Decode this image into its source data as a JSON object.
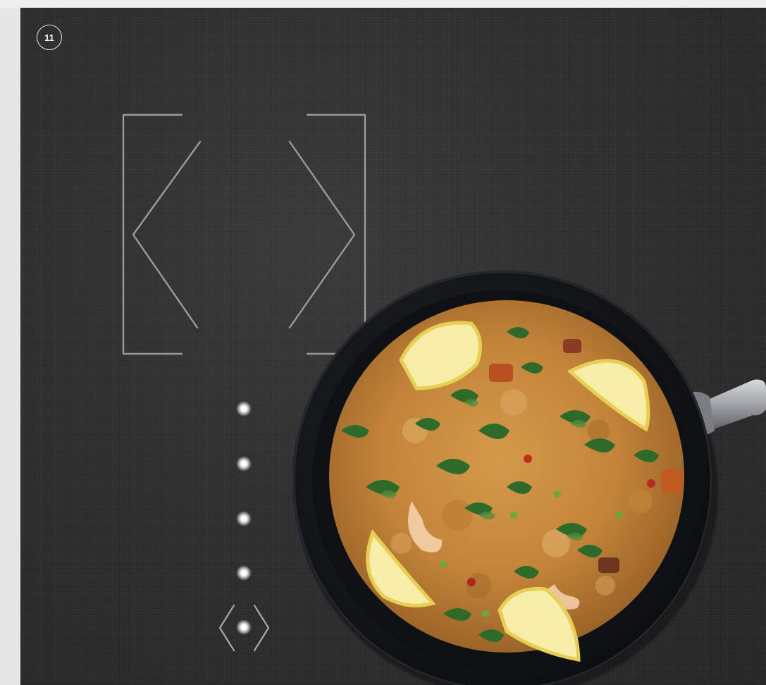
{
  "page": {
    "number": "11"
  },
  "colors": {
    "glass": "#2f2f30",
    "outline": "#9a9a9a",
    "led": "#ffffff",
    "pan": "#15191c",
    "rice": "#c58a3a",
    "herb": "#2f6b2a",
    "lemon": "#f2e38a"
  },
  "cooktop": {
    "zone_markings": [
      "left-chevron-bracket",
      "right-chevron-bracket"
    ],
    "indicator_count": 5,
    "control_symbol": "flex-zone-chevrons"
  },
  "dish": {
    "description_icon": "paella-pan"
  }
}
